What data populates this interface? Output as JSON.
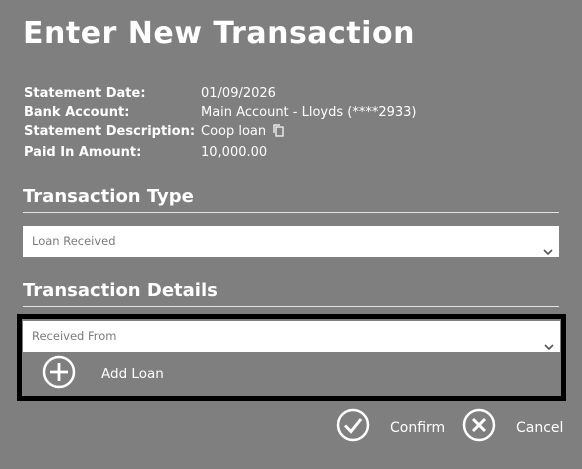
{
  "title": "Enter New Transaction",
  "statement": {
    "date_label": "Statement Date:",
    "date_value": "01/09/2026",
    "account_label": "Bank Account:",
    "account_value": "Main Account - Lloyds (****2933)",
    "description_label": "Statement Description:",
    "description_value": "Coop loan",
    "amount_label": "Paid In Amount:",
    "amount_value": "10,000.00"
  },
  "transaction_type": {
    "heading": "Transaction Type",
    "selected": "Loan Received"
  },
  "transaction_details": {
    "heading": "Transaction Details",
    "received_from_placeholder": "Received From",
    "add_loan_label": "Add Loan"
  },
  "actions": {
    "confirm_label": "Confirm",
    "cancel_label": "Cancel"
  },
  "colors": {
    "background": "#7f7f7f",
    "text": "#ffffff",
    "focus_border": "#000000"
  }
}
